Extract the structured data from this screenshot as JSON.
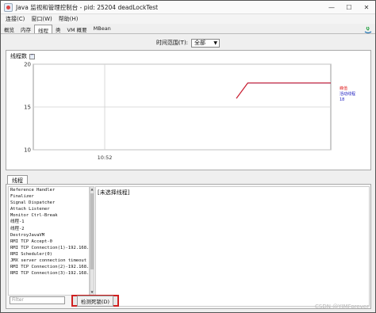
{
  "window": {
    "title": "Java 监视和管理控制台 - pid: 25204 deadLockTest",
    "controls": [
      "—",
      "☐",
      "✕"
    ]
  },
  "menu": [
    "连接(C)",
    "窗口(W)",
    "帮助(H)"
  ],
  "tabs": [
    {
      "label": "概览",
      "active": false
    },
    {
      "label": "内存",
      "active": false
    },
    {
      "label": "线程",
      "active": true
    },
    {
      "label": "类",
      "active": false
    },
    {
      "label": "VM 概要",
      "active": false
    },
    {
      "label": "MBean",
      "active": false
    }
  ],
  "time_range": {
    "label": "时间范围(T):",
    "value": "全部"
  },
  "chart": {
    "title": "线程数",
    "expand_icon": "^",
    "legend": [
      {
        "label": "峰值",
        "color": "#e02020"
      },
      {
        "label": "活动线程",
        "color": "#2020c0"
      },
      {
        "label": "18",
        "color": "#2020c0"
      }
    ]
  },
  "chart_data": {
    "type": "line",
    "title": "线程数",
    "xlabel": "",
    "ylabel": "",
    "x_tick_labels": [
      "10:52"
    ],
    "y_ticks": [
      10,
      15,
      20
    ],
    "ylim": [
      10,
      20
    ],
    "grid": true,
    "legend_position": "right",
    "series": [
      {
        "name": "峰值",
        "color": "#e02020",
        "points": [
          [
            0,
            16
          ],
          [
            0.12,
            17.8
          ],
          [
            1,
            17.8
          ]
        ]
      },
      {
        "name": "活动线程",
        "color": "#2020c0",
        "points": [
          [
            0,
            16
          ],
          [
            0.12,
            17.8
          ],
          [
            1,
            17.8
          ]
        ]
      }
    ]
  },
  "threads": {
    "tab_label": "线程",
    "list": [
      "Reference Handler",
      "Finalizer",
      "Signal Dispatcher",
      "Attach Listener",
      "Monitor Ctrl-Break",
      "线程-1",
      "线程-2",
      "DestroyJavaVM",
      "RMI TCP Accept-0",
      "RMI TCP Connection(1)-192.168.",
      "RMI Scheduler(0)",
      "JMX server connection timeout",
      "RMI TCP Connection(2)-192.168.",
      "RMI TCP Connection(3)-192.168."
    ],
    "detail_text": "[未选择线程]",
    "filter_placeholder": "Filter",
    "detect_deadlock_label": "检测死锁(D)"
  },
  "watermark": "CSDN @YIMForever"
}
